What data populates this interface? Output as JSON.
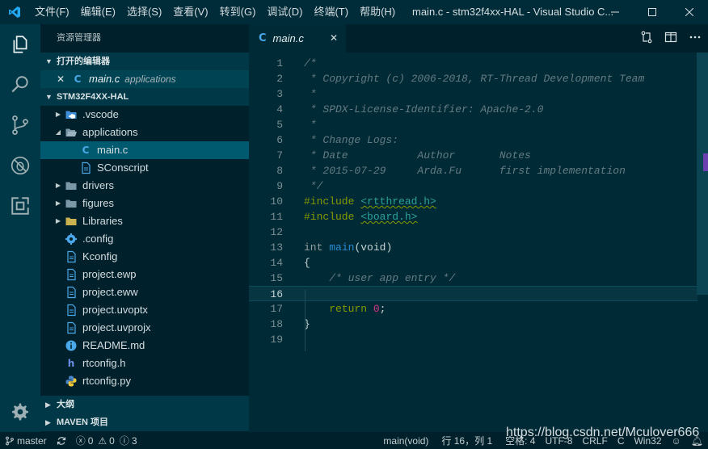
{
  "titlebar": {
    "menus": [
      "文件(F)",
      "编辑(E)",
      "选择(S)",
      "查看(V)",
      "转到(G)",
      "调试(D)",
      "终端(T)",
      "帮助(H)"
    ],
    "window_title": "main.c - stm32f4xx-HAL - Visual Studio C...",
    "controls": {
      "minimize": "─",
      "maximize": "☐",
      "close": "✕"
    }
  },
  "activity_bar": {
    "icons": [
      "files-icon",
      "search-icon",
      "source-control-icon",
      "debug-icon",
      "extensions-icon",
      "settings-gear-icon"
    ]
  },
  "sidebar": {
    "title": "资源管理器",
    "open_editors": {
      "header": "打开的编辑器",
      "items": [
        {
          "name": "main.c",
          "folder": "applications",
          "icon": "C"
        }
      ]
    },
    "project": {
      "header": "STM32F4XX-HAL",
      "items": [
        {
          "label": ".vscode",
          "type": "folder",
          "level": 0,
          "expanded": false
        },
        {
          "label": "applications",
          "type": "folder",
          "level": 0,
          "expanded": true
        },
        {
          "label": "main.c",
          "type": "c",
          "level": 1,
          "selected": true
        },
        {
          "label": "SConscript",
          "type": "file",
          "level": 1
        },
        {
          "label": "drivers",
          "type": "folder",
          "level": 0,
          "expanded": false
        },
        {
          "label": "figures",
          "type": "folder",
          "level": 0,
          "expanded": false
        },
        {
          "label": "Libraries",
          "type": "folder-lib",
          "level": 0,
          "expanded": false
        },
        {
          "label": ".config",
          "type": "gear",
          "level": 0
        },
        {
          "label": "Kconfig",
          "type": "file",
          "level": 0
        },
        {
          "label": "project.ewp",
          "type": "file",
          "level": 0
        },
        {
          "label": "project.eww",
          "type": "file",
          "level": 0
        },
        {
          "label": "project.uvoptx",
          "type": "file",
          "level": 0
        },
        {
          "label": "project.uvprojx",
          "type": "file",
          "level": 0
        },
        {
          "label": "README.md",
          "type": "info",
          "level": 0
        },
        {
          "label": "rtconfig.h",
          "type": "h",
          "level": 0
        },
        {
          "label": "rtconfig.py",
          "type": "python",
          "level": 0
        }
      ]
    },
    "outline_header": "大纲",
    "maven_header": "MAVEN 项目"
  },
  "editor": {
    "tab": {
      "label": "main.c",
      "icon": "C",
      "close": "✕"
    },
    "lines": [
      {
        "n": "1",
        "html": "<span class='cm'>/*</span>"
      },
      {
        "n": "2",
        "html": "<span class='cm'> * Copyright (c) 2006-2018, RT-Thread Development Team</span>"
      },
      {
        "n": "3",
        "html": "<span class='cm'> *</span>"
      },
      {
        "n": "4",
        "html": "<span class='cm'> * SPDX-License-Identifier: Apache-2.0</span>"
      },
      {
        "n": "5",
        "html": "<span class='cm'> *</span>"
      },
      {
        "n": "6",
        "html": "<span class='cm'> * Change Logs:</span>"
      },
      {
        "n": "7",
        "html": "<span class='cm'> * Date           Author       Notes</span>"
      },
      {
        "n": "8",
        "html": "<span class='cm'> * 2015-07-29     Arda.Fu      first implementation</span>"
      },
      {
        "n": "9",
        "html": "<span class='cm'> */</span>"
      },
      {
        "n": "10",
        "html": "<span class='pp'>#include</span> <span class='str'>&lt;rtthread.h&gt;</span>"
      },
      {
        "n": "11",
        "html": "<span class='pp'>#include</span> <span class='str'>&lt;board.h&gt;</span>"
      },
      {
        "n": "12",
        "html": ""
      },
      {
        "n": "13",
        "html": "<span class='kw'>int</span> <span class='fn'>main</span><span class='pl'>(void)</span>"
      },
      {
        "n": "14",
        "html": "<span class='pl'>{</span>"
      },
      {
        "n": "15",
        "html": "    <span class='cm'>/* user app entry */</span>"
      },
      {
        "n": "16",
        "html": "",
        "current": true
      },
      {
        "n": "17",
        "html": "    <span class='ret'>return</span> <span class='num'>0</span><span class='pl'>;</span>"
      },
      {
        "n": "18",
        "html": "<span class='pl'>}</span>"
      },
      {
        "n": "19",
        "html": ""
      }
    ]
  },
  "statusbar": {
    "branch": "master",
    "errors": "0",
    "warnings": "0",
    "infos": "3",
    "function": "main(void)",
    "position": "行 16，列 1",
    "spaces": "空格: 4",
    "encoding": "UTF-8",
    "eol": "CRLF",
    "language": "C",
    "platform": "Win32"
  },
  "watermark": "https://blog.csdn.net/Mculover666"
}
